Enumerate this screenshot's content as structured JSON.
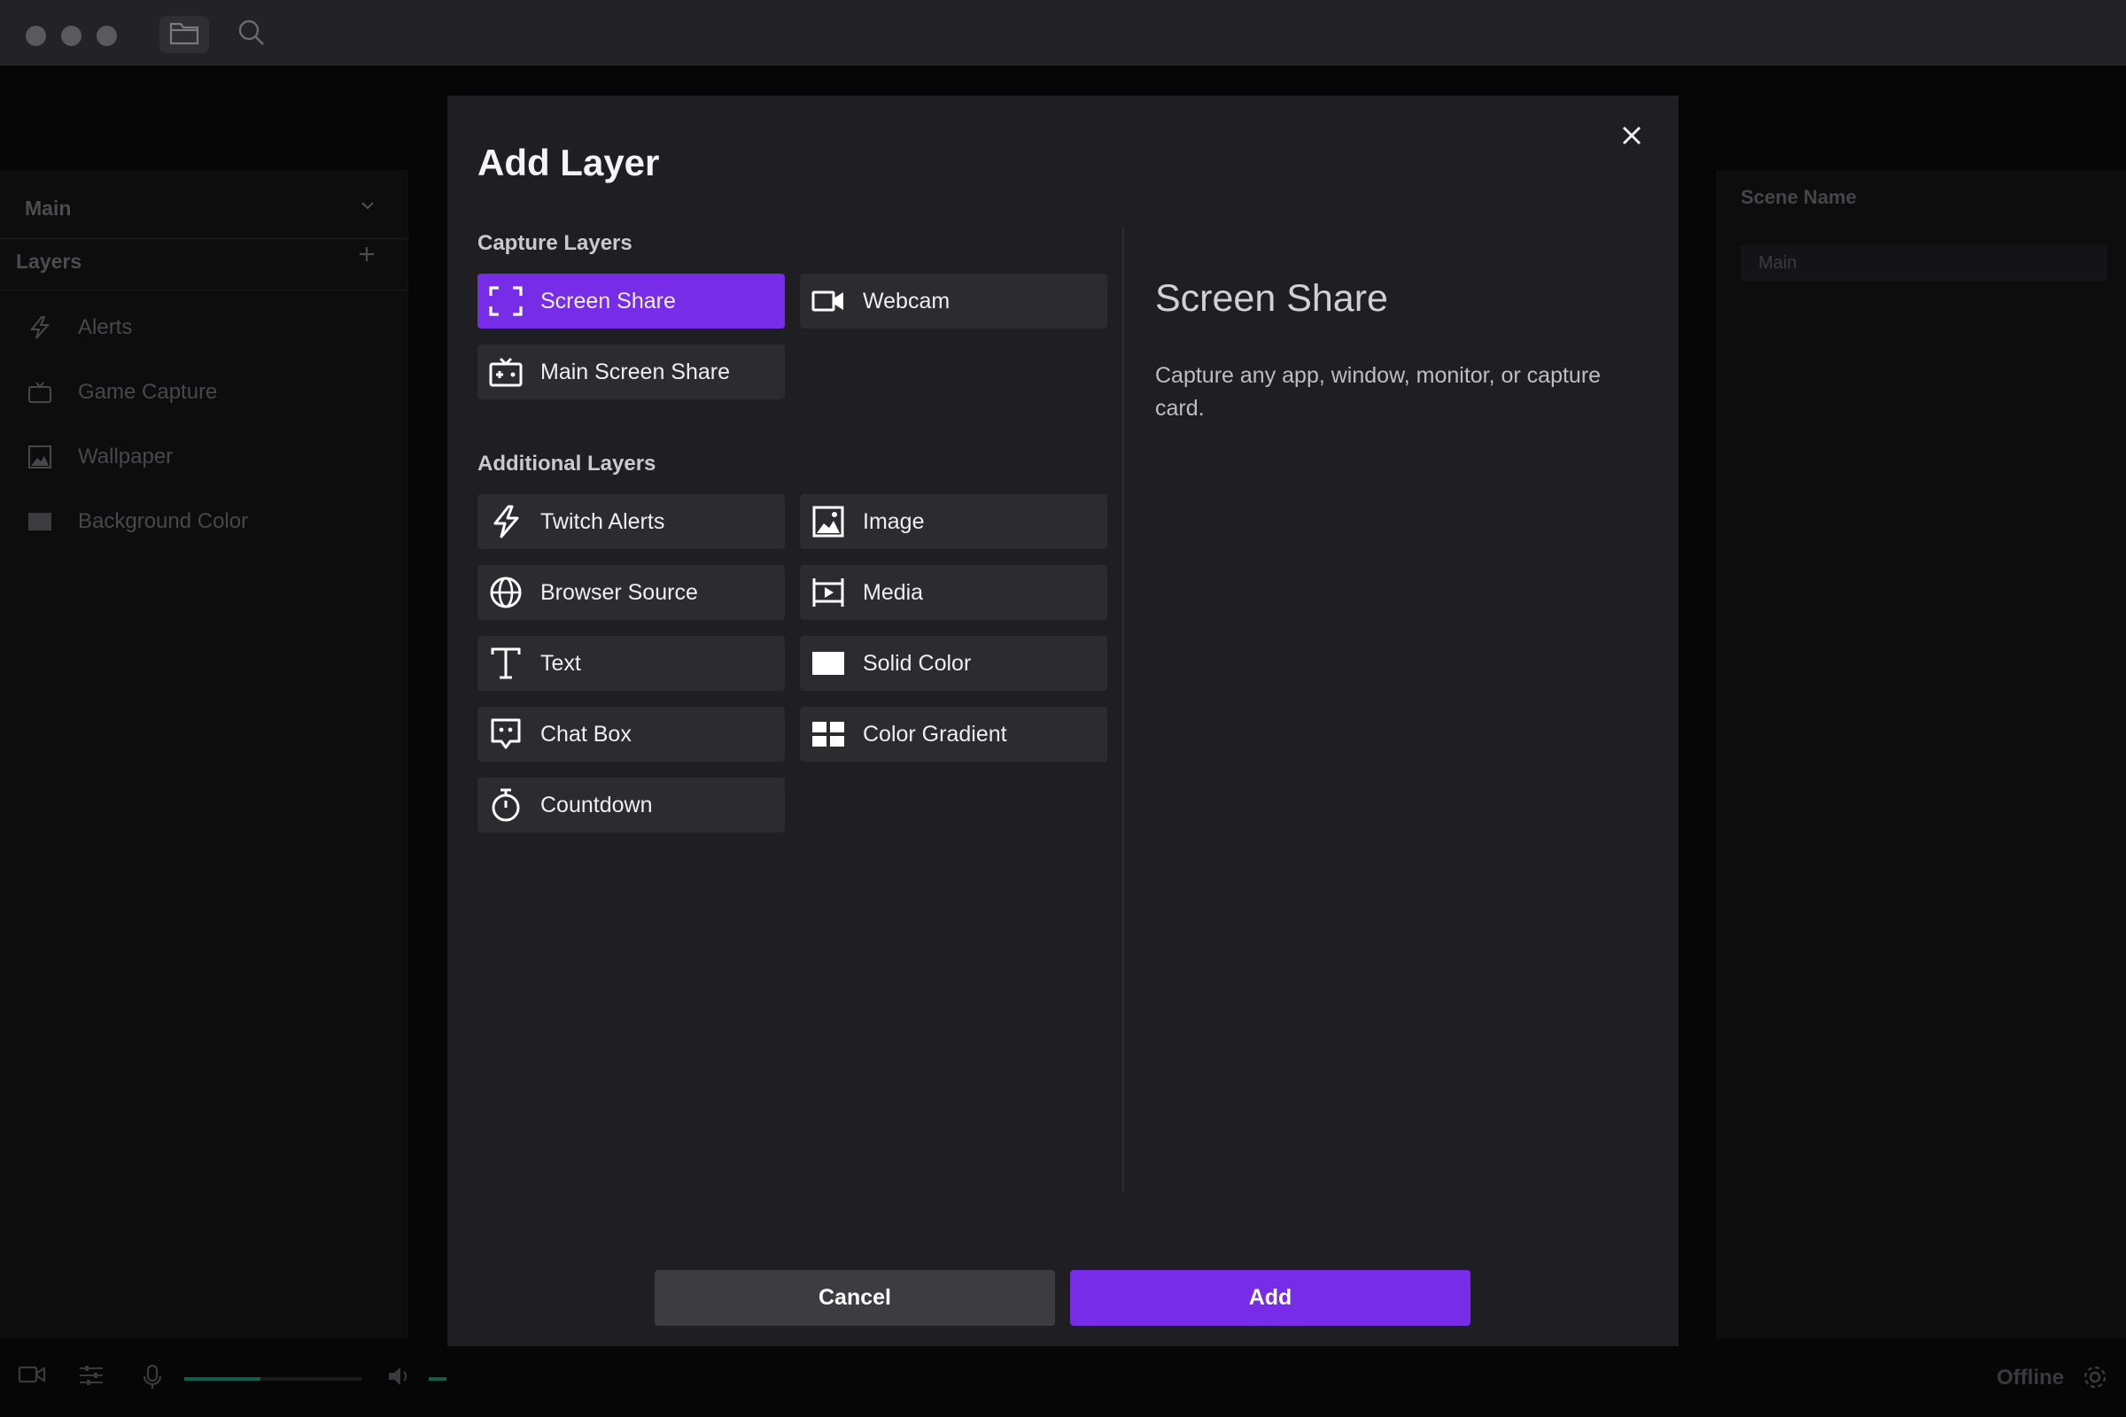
{
  "background_app": {
    "scene_selector": "Main",
    "layers_heading": "Layers",
    "layers": [
      {
        "label": "Alerts",
        "icon": "lightning-icon"
      },
      {
        "label": "Game Capture",
        "icon": "gamepad-icon"
      },
      {
        "label": "Wallpaper",
        "icon": "image-icon"
      },
      {
        "label": "Background Color",
        "icon": "solid-color-icon"
      }
    ],
    "right_panel": {
      "label": "Scene Name",
      "input_value": "Main"
    },
    "status": "Offline"
  },
  "modal": {
    "title": "Add Layer",
    "capture_heading": "Capture Layers",
    "capture_layers": [
      {
        "label": "Screen Share",
        "icon": "screen-share-icon",
        "selected": true
      },
      {
        "label": "Webcam",
        "icon": "webcam-icon",
        "selected": false
      },
      {
        "label": "Main Screen Share",
        "icon": "gamepad-icon",
        "selected": false
      }
    ],
    "additional_heading": "Additional Layers",
    "additional_layers": [
      {
        "label": "Twitch Alerts",
        "icon": "lightning-icon"
      },
      {
        "label": "Image",
        "icon": "image-icon"
      },
      {
        "label": "Browser Source",
        "icon": "globe-icon"
      },
      {
        "label": "Media",
        "icon": "media-icon"
      },
      {
        "label": "Text",
        "icon": "text-icon"
      },
      {
        "label": "Solid Color",
        "icon": "solid-color-icon"
      },
      {
        "label": "Chat Box",
        "icon": "chat-icon"
      },
      {
        "label": "Color Gradient",
        "icon": "gradient-icon"
      },
      {
        "label": "Countdown",
        "icon": "timer-icon"
      }
    ],
    "detail": {
      "title": "Screen Share",
      "description": "Capture any app, window, monitor, or capture card."
    },
    "cancel_label": "Cancel",
    "add_label": "Add"
  },
  "colors": {
    "accent": "#772ce8",
    "modal_bg": "#1f1f23",
    "button_bg": "#2b2b30"
  }
}
